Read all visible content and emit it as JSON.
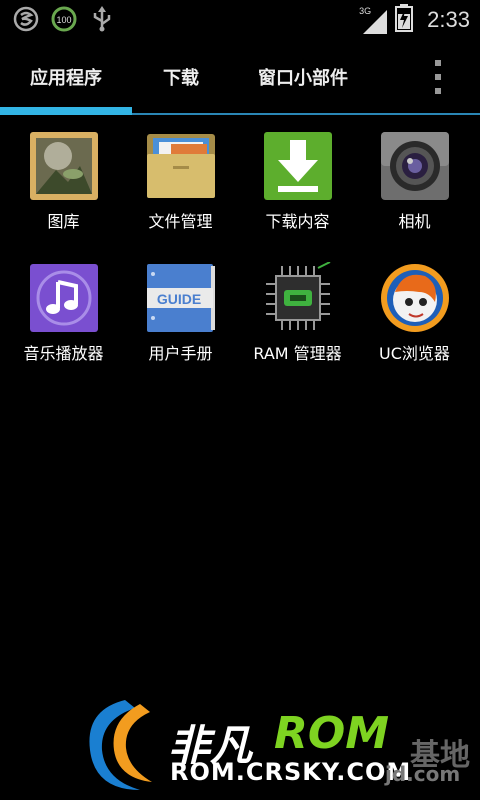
{
  "status_bar": {
    "left_icons": [
      "360-security-icon",
      "battery-saver-100-icon",
      "usb-icon"
    ],
    "battery_saver_value": "100",
    "network_type": "3G",
    "time": "2:33"
  },
  "tabs": {
    "apps_label": "应用程序",
    "download_label": "下载",
    "widgets_label": "窗口小部件",
    "active_tab": "应用程序",
    "accent_color": "#33b5e5"
  },
  "apps": [
    {
      "label": "图库",
      "icon": "gallery-icon"
    },
    {
      "label": "文件管理",
      "icon": "folder-icon"
    },
    {
      "label": "下载内容",
      "icon": "download-icon"
    },
    {
      "label": "相机",
      "icon": "camera-icon"
    },
    {
      "label": "音乐播放器",
      "icon": "music-icon"
    },
    {
      "label": "用户手册",
      "icon": "guide-book-icon"
    },
    {
      "label": "RAM 管理器",
      "icon": "ram-chip-icon"
    },
    {
      "label": "UC浏览器",
      "icon": "uc-squirrel-icon"
    }
  ],
  "guide_text": "GUIDE",
  "watermark": {
    "brand": "非凡",
    "rom": "ROM",
    "base": "基地",
    "url": "ROM.CRSKY.COM",
    "url_tail": "jd.com"
  }
}
